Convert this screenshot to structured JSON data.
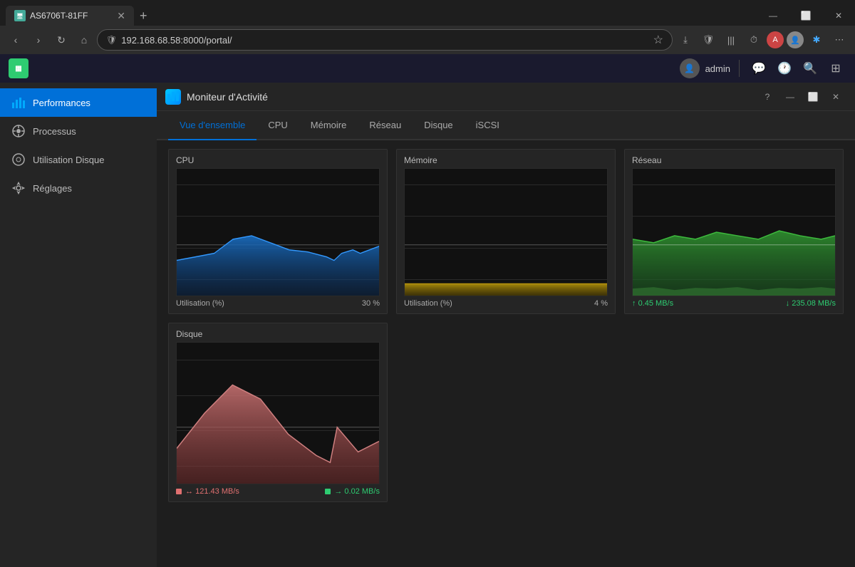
{
  "browser": {
    "tab_title": "AS6706T-81FF",
    "tab_favicon": "🖥",
    "address": "192.168.68.58:8000/portal/",
    "new_tab_label": "+",
    "win_minimize": "—",
    "win_restore": "⬜",
    "win_close": "✕"
  },
  "app_toolbar": {
    "user_label": "admin",
    "logo_icon": "▦"
  },
  "app": {
    "title": "Moniteur d'Activité",
    "icon_label": "▦",
    "help_btn": "?",
    "minimize_btn": "—",
    "restore_btn": "⬜",
    "close_btn": "✕"
  },
  "sidebar": {
    "items": [
      {
        "id": "performances",
        "label": "Performances",
        "icon": "📊",
        "active": true
      },
      {
        "id": "processus",
        "label": "Processus",
        "icon": "🔄",
        "active": false
      },
      {
        "id": "utilisation-disque",
        "label": "Utilisation Disque",
        "icon": "💿",
        "active": false
      },
      {
        "id": "reglages",
        "label": "Réglages",
        "icon": "⚙",
        "active": false
      }
    ]
  },
  "tabs": {
    "items": [
      {
        "id": "vue-densemble",
        "label": "Vue d'ensemble",
        "active": true
      },
      {
        "id": "cpu",
        "label": "CPU",
        "active": false
      },
      {
        "id": "memoire",
        "label": "Mémoire",
        "active": false
      },
      {
        "id": "reseau",
        "label": "Réseau",
        "active": false
      },
      {
        "id": "disque",
        "label": "Disque",
        "active": false
      },
      {
        "id": "iscsi",
        "label": "iSCSI",
        "active": false
      }
    ]
  },
  "charts": {
    "cpu": {
      "title": "CPU",
      "footer_label": "Utilisation (%)",
      "footer_value": "30 %"
    },
    "memoire": {
      "title": "Mémoire",
      "footer_label": "Utilisation (%)",
      "footer_value": "4 %"
    },
    "reseau": {
      "title": "Réseau",
      "upload_label": "0.45 MB/s",
      "download_label": "235.08 MB/s"
    },
    "disque": {
      "title": "Disque",
      "read_label": "121.43 MB/s",
      "write_label": "0.02 MB/s"
    }
  }
}
